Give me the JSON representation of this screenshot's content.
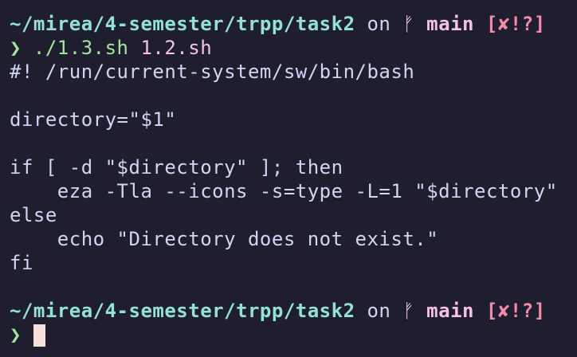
{
  "prompt": {
    "path": "~/mirea/4-semester/trpp/task2",
    "on": " on ",
    "branch_icon": "ᚠ",
    "branch": " main",
    "status": " [✘!?]",
    "chevron": "❯"
  },
  "command": {
    "program": "./1.3.sh",
    "argument": " 1.2.sh"
  },
  "output": [
    "#! /run/current-system/sw/bin/bash",
    "",
    "directory=\"$1\"",
    "",
    "if [ -d \"$directory\" ]; then",
    "    eza -Tla --icons -s=type -L=1 \"$directory\"",
    "else",
    "    echo \"Directory does not exist.\"",
    "fi",
    ""
  ],
  "colors": {
    "background": "#1e1e2e",
    "path": "#94e2d5",
    "branch": "#f5c2e7",
    "status": "#f38ba8",
    "chevron": "#a6e3a1",
    "cursor": "#f5e0dc"
  }
}
